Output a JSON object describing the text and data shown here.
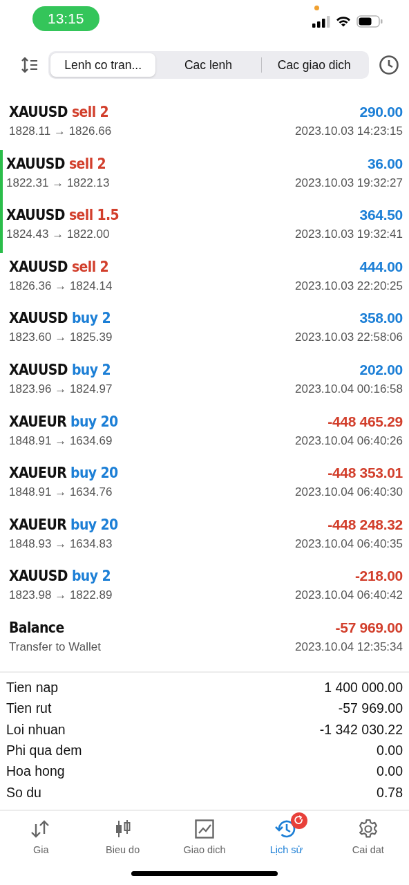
{
  "status_bar": {
    "time": "13:15"
  },
  "toolbar": {
    "segments": [
      {
        "label": "Lenh co tran...",
        "selected": true
      },
      {
        "label": "Cac lenh",
        "selected": false
      },
      {
        "label": "Cac giao dich",
        "selected": false
      }
    ]
  },
  "trades": [
    {
      "symbol": "XAUUSD",
      "side": "sell",
      "volume": "2",
      "sell": true,
      "prices": "1828.11 → 1826.66",
      "profit": "290.00",
      "loss": false,
      "time": "2023.10.03 14:23:15",
      "marked": false
    },
    {
      "symbol": "XAUUSD",
      "side": "sell",
      "volume": "2",
      "sell": true,
      "prices": "1822.31 → 1822.13",
      "profit": "36.00",
      "loss": false,
      "time": "2023.10.03 19:32:27",
      "marked": true
    },
    {
      "symbol": "XAUUSD",
      "side": "sell",
      "volume": "1.5",
      "sell": true,
      "prices": "1824.43 → 1822.00",
      "profit": "364.50",
      "loss": false,
      "time": "2023.10.03 19:32:41",
      "marked": true
    },
    {
      "symbol": "XAUUSD",
      "side": "sell",
      "volume": "2",
      "sell": true,
      "prices": "1826.36 → 1824.14",
      "profit": "444.00",
      "loss": false,
      "time": "2023.10.03 22:20:25",
      "marked": false
    },
    {
      "symbol": "XAUUSD",
      "side": "buy",
      "volume": "2",
      "sell": false,
      "prices": "1823.60 → 1825.39",
      "profit": "358.00",
      "loss": false,
      "time": "2023.10.03 22:58:06",
      "marked": false
    },
    {
      "symbol": "XAUUSD",
      "side": "buy",
      "volume": "2",
      "sell": false,
      "prices": "1823.96 → 1824.97",
      "profit": "202.00",
      "loss": false,
      "time": "2023.10.04 00:16:58",
      "marked": false
    },
    {
      "symbol": "XAUEUR",
      "side": "buy",
      "volume": "20",
      "sell": false,
      "prices": "1848.91 → 1634.69",
      "profit": "-448 465.29",
      "loss": true,
      "time": "2023.10.04 06:40:26",
      "marked": false
    },
    {
      "symbol": "XAUEUR",
      "side": "buy",
      "volume": "20",
      "sell": false,
      "prices": "1848.91 → 1634.76",
      "profit": "-448 353.01",
      "loss": true,
      "time": "2023.10.04 06:40:30",
      "marked": false
    },
    {
      "symbol": "XAUEUR",
      "side": "buy",
      "volume": "20",
      "sell": false,
      "prices": "1848.93 → 1634.83",
      "profit": "-448 248.32",
      "loss": true,
      "time": "2023.10.04 06:40:35",
      "marked": false
    },
    {
      "symbol": "XAUUSD",
      "side": "buy",
      "volume": "2",
      "sell": false,
      "prices": "1823.98 → 1822.89",
      "profit": "-218.00",
      "loss": true,
      "time": "2023.10.04 06:40:42",
      "marked": false
    }
  ],
  "balance": {
    "title": "Balance",
    "comment": "Transfer to Wallet",
    "amount": "-57 969.00",
    "loss": true,
    "time": "2023.10.04 12:35:34"
  },
  "summary": [
    {
      "label": "Tien nap",
      "value": "1 400 000.00"
    },
    {
      "label": "Tien rut",
      "value": "-57 969.00"
    },
    {
      "label": "Loi nhuan",
      "value": "-1 342 030.22"
    },
    {
      "label": "Phi qua dem",
      "value": "0.00"
    },
    {
      "label": "Hoa hong",
      "value": "0.00"
    },
    {
      "label": "So du",
      "value": "0.78"
    }
  ],
  "tab_bar": [
    {
      "kind": "quotes",
      "label": "Gia",
      "selected": false
    },
    {
      "kind": "chart",
      "label": "Bieu do",
      "selected": false
    },
    {
      "kind": "trade",
      "label": "Giao dich",
      "selected": false
    },
    {
      "kind": "history",
      "label": "Lịch sử",
      "selected": true
    },
    {
      "kind": "settings",
      "label": "Cai dat",
      "selected": false
    }
  ]
}
